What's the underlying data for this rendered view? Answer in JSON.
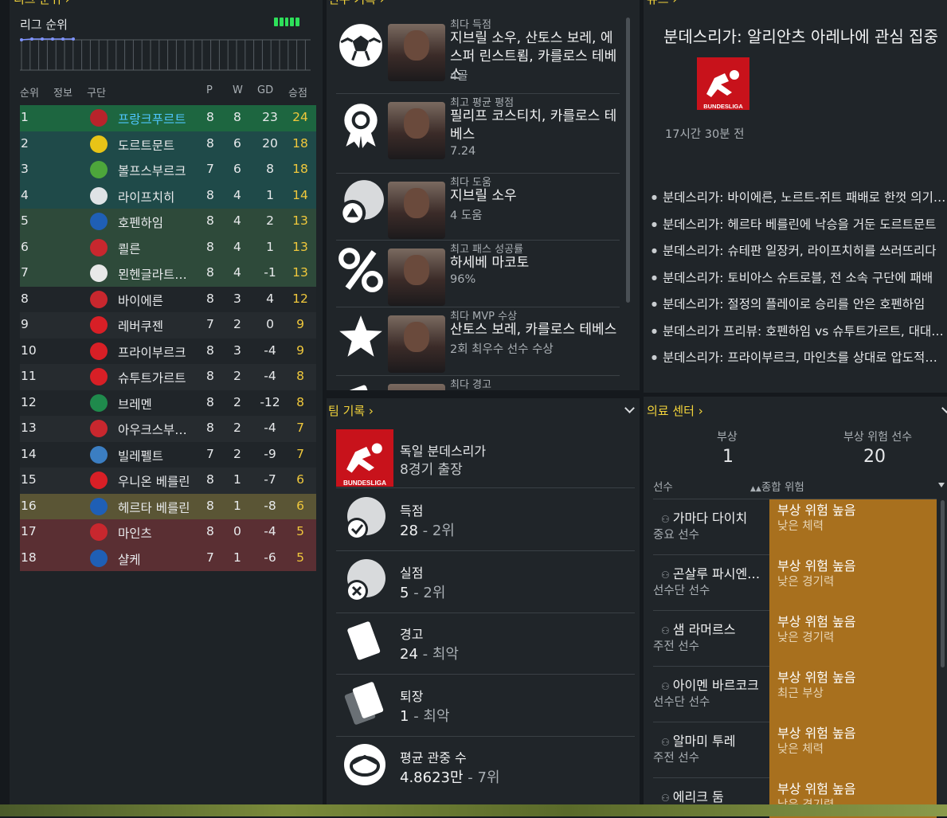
{
  "league_table": {
    "title": "리그 순위",
    "subtitle": "리그 순위",
    "columns": {
      "pos": "순위",
      "info": "정보",
      "club": "구단",
      "p": "P",
      "w": "W",
      "gd": "GD",
      "pts": "승점"
    },
    "rows": [
      {
        "pos": "1",
        "club": "프랑크푸르트",
        "p": "8",
        "w": "8",
        "gd": "23",
        "pts": "24",
        "bg": "#1d6640",
        "crest": "#b8232b",
        "hl": true
      },
      {
        "pos": "2",
        "club": "도르트문트",
        "p": "8",
        "w": "6",
        "gd": "20",
        "pts": "18",
        "bg": "#1f4a49",
        "crest": "#e8c417"
      },
      {
        "pos": "3",
        "club": "볼프스부르크",
        "p": "7",
        "w": "6",
        "gd": "8",
        "pts": "18",
        "bg": "#1f4a49",
        "crest": "#4da63b"
      },
      {
        "pos": "4",
        "club": "라이프치히",
        "p": "8",
        "w": "4",
        "gd": "1",
        "pts": "14",
        "bg": "#1f4a49",
        "crest": "#dfe3e6"
      },
      {
        "pos": "5",
        "club": "호펜하임",
        "p": "8",
        "w": "4",
        "gd": "2",
        "pts": "13",
        "bg": "#2e4a3a",
        "crest": "#1f5fb5"
      },
      {
        "pos": "6",
        "club": "쾰른",
        "p": "8",
        "w": "4",
        "gd": "1",
        "pts": "13",
        "bg": "#2e4a3a",
        "crest": "#c8272e"
      },
      {
        "pos": "7",
        "club": "묀헨글라트…",
        "p": "8",
        "w": "4",
        "gd": "-1",
        "pts": "13",
        "bg": "#2e4a3a",
        "crest": "#e8e8e8"
      },
      {
        "pos": "8",
        "club": "바이에른",
        "p": "8",
        "w": "3",
        "gd": "4",
        "pts": "12",
        "bg": "#202529",
        "crest": "#c8272e"
      },
      {
        "pos": "9",
        "club": "레버쿠젠",
        "p": "7",
        "w": "2",
        "gd": "0",
        "pts": "9",
        "bg": "#262b2f",
        "crest": "#d81f26"
      },
      {
        "pos": "10",
        "club": "프라이부르크",
        "p": "8",
        "w": "3",
        "gd": "-4",
        "pts": "9",
        "bg": "#202529",
        "crest": "#d81f26"
      },
      {
        "pos": "11",
        "club": "슈투트가르트",
        "p": "8",
        "w": "2",
        "gd": "-4",
        "pts": "8",
        "bg": "#262b2f",
        "crest": "#d81f26"
      },
      {
        "pos": "12",
        "club": "브레멘",
        "p": "8",
        "w": "2",
        "gd": "-12",
        "pts": "8",
        "bg": "#202529",
        "crest": "#1f8a4c"
      },
      {
        "pos": "13",
        "club": "아우크스부…",
        "p": "8",
        "w": "2",
        "gd": "-4",
        "pts": "7",
        "bg": "#262b2f",
        "crest": "#c8272e"
      },
      {
        "pos": "14",
        "club": "빌레펠트",
        "p": "7",
        "w": "2",
        "gd": "-9",
        "pts": "7",
        "bg": "#202529",
        "crest": "#3b7ec2"
      },
      {
        "pos": "15",
        "club": "우니온 베를린",
        "p": "8",
        "w": "1",
        "gd": "-7",
        "pts": "6",
        "bg": "#262b2f",
        "crest": "#d81f26"
      },
      {
        "pos": "16",
        "club": "헤르타 베를린",
        "p": "8",
        "w": "1",
        "gd": "-8",
        "pts": "6",
        "bg": "#5a5535",
        "crest": "#1f5fb5"
      },
      {
        "pos": "17",
        "club": "마인츠",
        "p": "8",
        "w": "0",
        "gd": "-4",
        "pts": "5",
        "bg": "#5a2f33",
        "crest": "#c8272e"
      },
      {
        "pos": "18",
        "club": "샬케",
        "p": "7",
        "w": "1",
        "gd": "-6",
        "pts": "5",
        "bg": "#5a2f33",
        "crest": "#1f5fb5"
      }
    ]
  },
  "season_records": {
    "title": "선수 기록",
    "items": [
      {
        "label": "최다 득점",
        "value": "지브릴 소우, 산토스 보레, 에스퍼 린스트룀, 카를로스 테베스",
        "sub": "4골",
        "icon": "soccer-ball-icon"
      },
      {
        "label": "최고 평균 평점",
        "value": "필리프 코스티치, 카를로스 테베스",
        "sub": "7.24",
        "icon": "medal-icon"
      },
      {
        "label": "최다 도움",
        "value": "지브릴 소우",
        "sub": "4 도움",
        "icon": "assist-ball-icon"
      },
      {
        "label": "최고 패스 성공률",
        "value": "하세베 마코토",
        "sub": "96%",
        "icon": "percent-icon"
      },
      {
        "label": "최다 MVP 수상",
        "value": "산토스 보레, 카를로스 테베스",
        "sub": "2회 최우수 선수 수상",
        "icon": "star-icon"
      },
      {
        "label": "최다 경고",
        "value": "",
        "sub": "",
        "icon": "yellow-card-icon"
      }
    ]
  },
  "news": {
    "title": "뉴스",
    "headline": "분데스리가: 알리안츠 아레나에 관심 집중",
    "logo_text": "BUNDESLIGA",
    "time": "17시간 30분 전",
    "items": [
      "분데스리가: 바이에른, 노르트-쥐트 패배로 한껏 의기…",
      "분데스리가: 헤르타 베를린에 낙승을 거둔 도르트문트",
      "분데스리가: 슈테판 일장커, 라이프치히를 쓰러뜨리다",
      "분데스리가: 토비아스 슈트로블, 전 소속 구단에 패배",
      "분데스리가: 절정의 플레이로 승리를 안은 호펜하임",
      "분데스리가 프리뷰: 호펜하임 vs 슈투트가르트, 대대적…",
      "분데스리가: 프라이부르크, 마인츠를 상대로 압도적인…"
    ]
  },
  "team_records": {
    "title": "팀 기록",
    "competition": "독일 분데스리가",
    "apps": "8경기 출장",
    "logo_text": "BUNDESLIGA",
    "items": [
      {
        "label": "득점",
        "value": "28",
        "rank": "2위",
        "icon": "goals-scored-icon"
      },
      {
        "label": "실점",
        "value": "5",
        "rank": "2위",
        "icon": "goals-conceded-icon"
      },
      {
        "label": "경고",
        "value": "24",
        "rank": "최악",
        "icon": "yellow-card-icon"
      },
      {
        "label": "퇴장",
        "value": "1",
        "rank": "최악",
        "icon": "red-card-icon"
      },
      {
        "label": "평균 관중 수",
        "value": "4.8623만",
        "rank": "7위",
        "icon": "stadium-icon"
      }
    ]
  },
  "medical": {
    "title": "의료 센터",
    "injured_label": "부상",
    "injured": "1",
    "risk_label": "부상 위험 선수",
    "risk": "20",
    "col_player": "선수",
    "col_risk": "종합 위험",
    "players": [
      {
        "name": "가마다 다이치",
        "role": "중요 선수",
        "risk": "부상 위험 높음",
        "reason": "낮은 체력"
      },
      {
        "name": "곤살루 파시엔…",
        "role": "선수단 선수",
        "risk": "부상 위험 높음",
        "reason": "낮은 경기력"
      },
      {
        "name": "샘 라머르스",
        "role": "주전 선수",
        "risk": "부상 위험 높음",
        "reason": "낮은 경기력"
      },
      {
        "name": "아이멘 바르코크",
        "role": "선수단 선수",
        "risk": "부상 위험 높음",
        "reason": "최근 부상"
      },
      {
        "name": "알마미 투레",
        "role": "주전 선수",
        "risk": "부상 위험 높음",
        "reason": "낮은 체력"
      },
      {
        "name": "에리크 둠",
        "role": "",
        "risk": "부상 위험 높음",
        "reason": "낮은 경기력"
      }
    ]
  }
}
